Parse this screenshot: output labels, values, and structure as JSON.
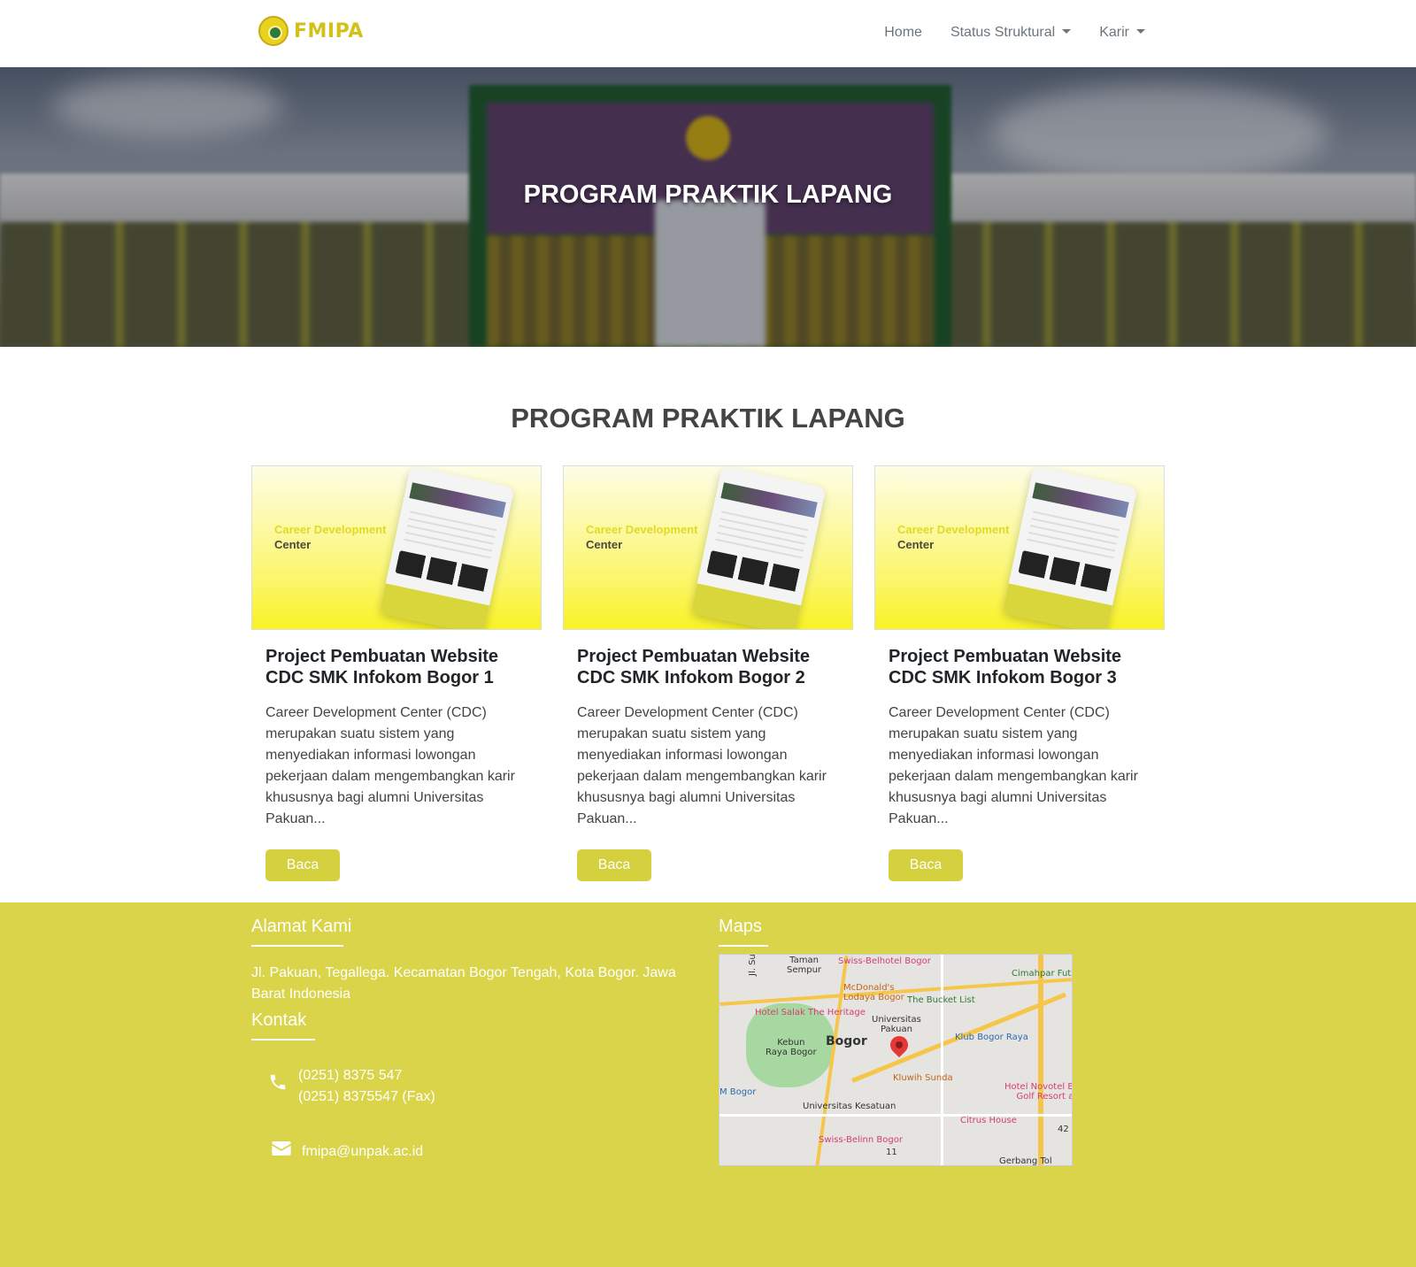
{
  "brand": {
    "name": "FMIPA"
  },
  "nav": {
    "home": "Home",
    "status_struktural": "Status Struktural",
    "karir": "Karir"
  },
  "hero": {
    "title": "PROGRAM PRAKTIK LAPANG"
  },
  "section": {
    "title": "PROGRAM PRAKTIK LAPANG"
  },
  "cards": [
    {
      "image_line1": "Career Development",
      "image_line2": "Center",
      "title": "Project Pembuatan Website CDC SMK Infokom Bogor 1",
      "text": "Career Development Center (CDC) merupakan suatu sistem yang menyediakan informasi lowongan pekerjaan dalam mengembangkan karir khususnya bagi alumni Universitas Pakuan...",
      "button": "Baca"
    },
    {
      "image_line1": "Career Development",
      "image_line2": "Center",
      "title": "Project Pembuatan Website CDC SMK Infokom Bogor 2",
      "text": "Career Development Center (CDC) merupakan suatu sistem yang menyediakan informasi lowongan pekerjaan dalam mengembangkan karir khususnya bagi alumni Universitas Pakuan...",
      "button": "Baca"
    },
    {
      "image_line1": "Career Development",
      "image_line2": "Center",
      "title": "Project Pembuatan Website CDC SMK Infokom Bogor 3",
      "text": "Career Development Center (CDC) merupakan suatu sistem yang menyediakan informasi lowongan pekerjaan dalam mengembangkan karir khususnya bagi alumni Universitas Pakuan...",
      "button": "Baca"
    }
  ],
  "footer": {
    "address_heading": "Alamat Kami",
    "address": "Jl. Pakuan, Tegallega. Kecamatan Bogor Tengah, Kota Bogor. Jawa Barat Indonesia",
    "contact_heading": "Kontak",
    "phone": "(0251) 8375 547",
    "fax": "(0251) 8375547 (Fax)",
    "email": "fmipa@unpak.ac.id",
    "maps_heading": "Maps"
  },
  "map": {
    "labels": {
      "taman_sempur": "Taman\nSempur",
      "swiss_belhotel": "Swiss-Belhotel Bogor",
      "mcdonalds": "McDonald's\nLodaya Bogor",
      "bucket_list": "The Bucket List",
      "cimahpar": "Cimahpar Futs",
      "hotel_salak": "Hotel Salak The Heritage",
      "universitas_pakuan": "Universitas\nPakuan",
      "kebun_raya": "Kebun\nRaya Bogor",
      "bogor": "Bogor",
      "klub_bogor": "Klub Bogor Raya",
      "kluwih": "Kluwih Sunda",
      "m_bogor": "M Bogor",
      "universitas_kesatuan": "Universitas Kesatuan",
      "hotel_novotel": "Hotel Novotel B\nGolf Resort a",
      "citrus_house": "Citrus House",
      "swiss_belinn": "Swiss-Belinn Bogor",
      "gerbang_tol": "Gerbang Tol",
      "sudirman": "Jl. Sudirman",
      "route_42": "42",
      "route_11": "11"
    }
  },
  "colors": {
    "accent": "#d4d03e",
    "footer_bg": "#d9d44a",
    "brand": "#d2c117"
  }
}
